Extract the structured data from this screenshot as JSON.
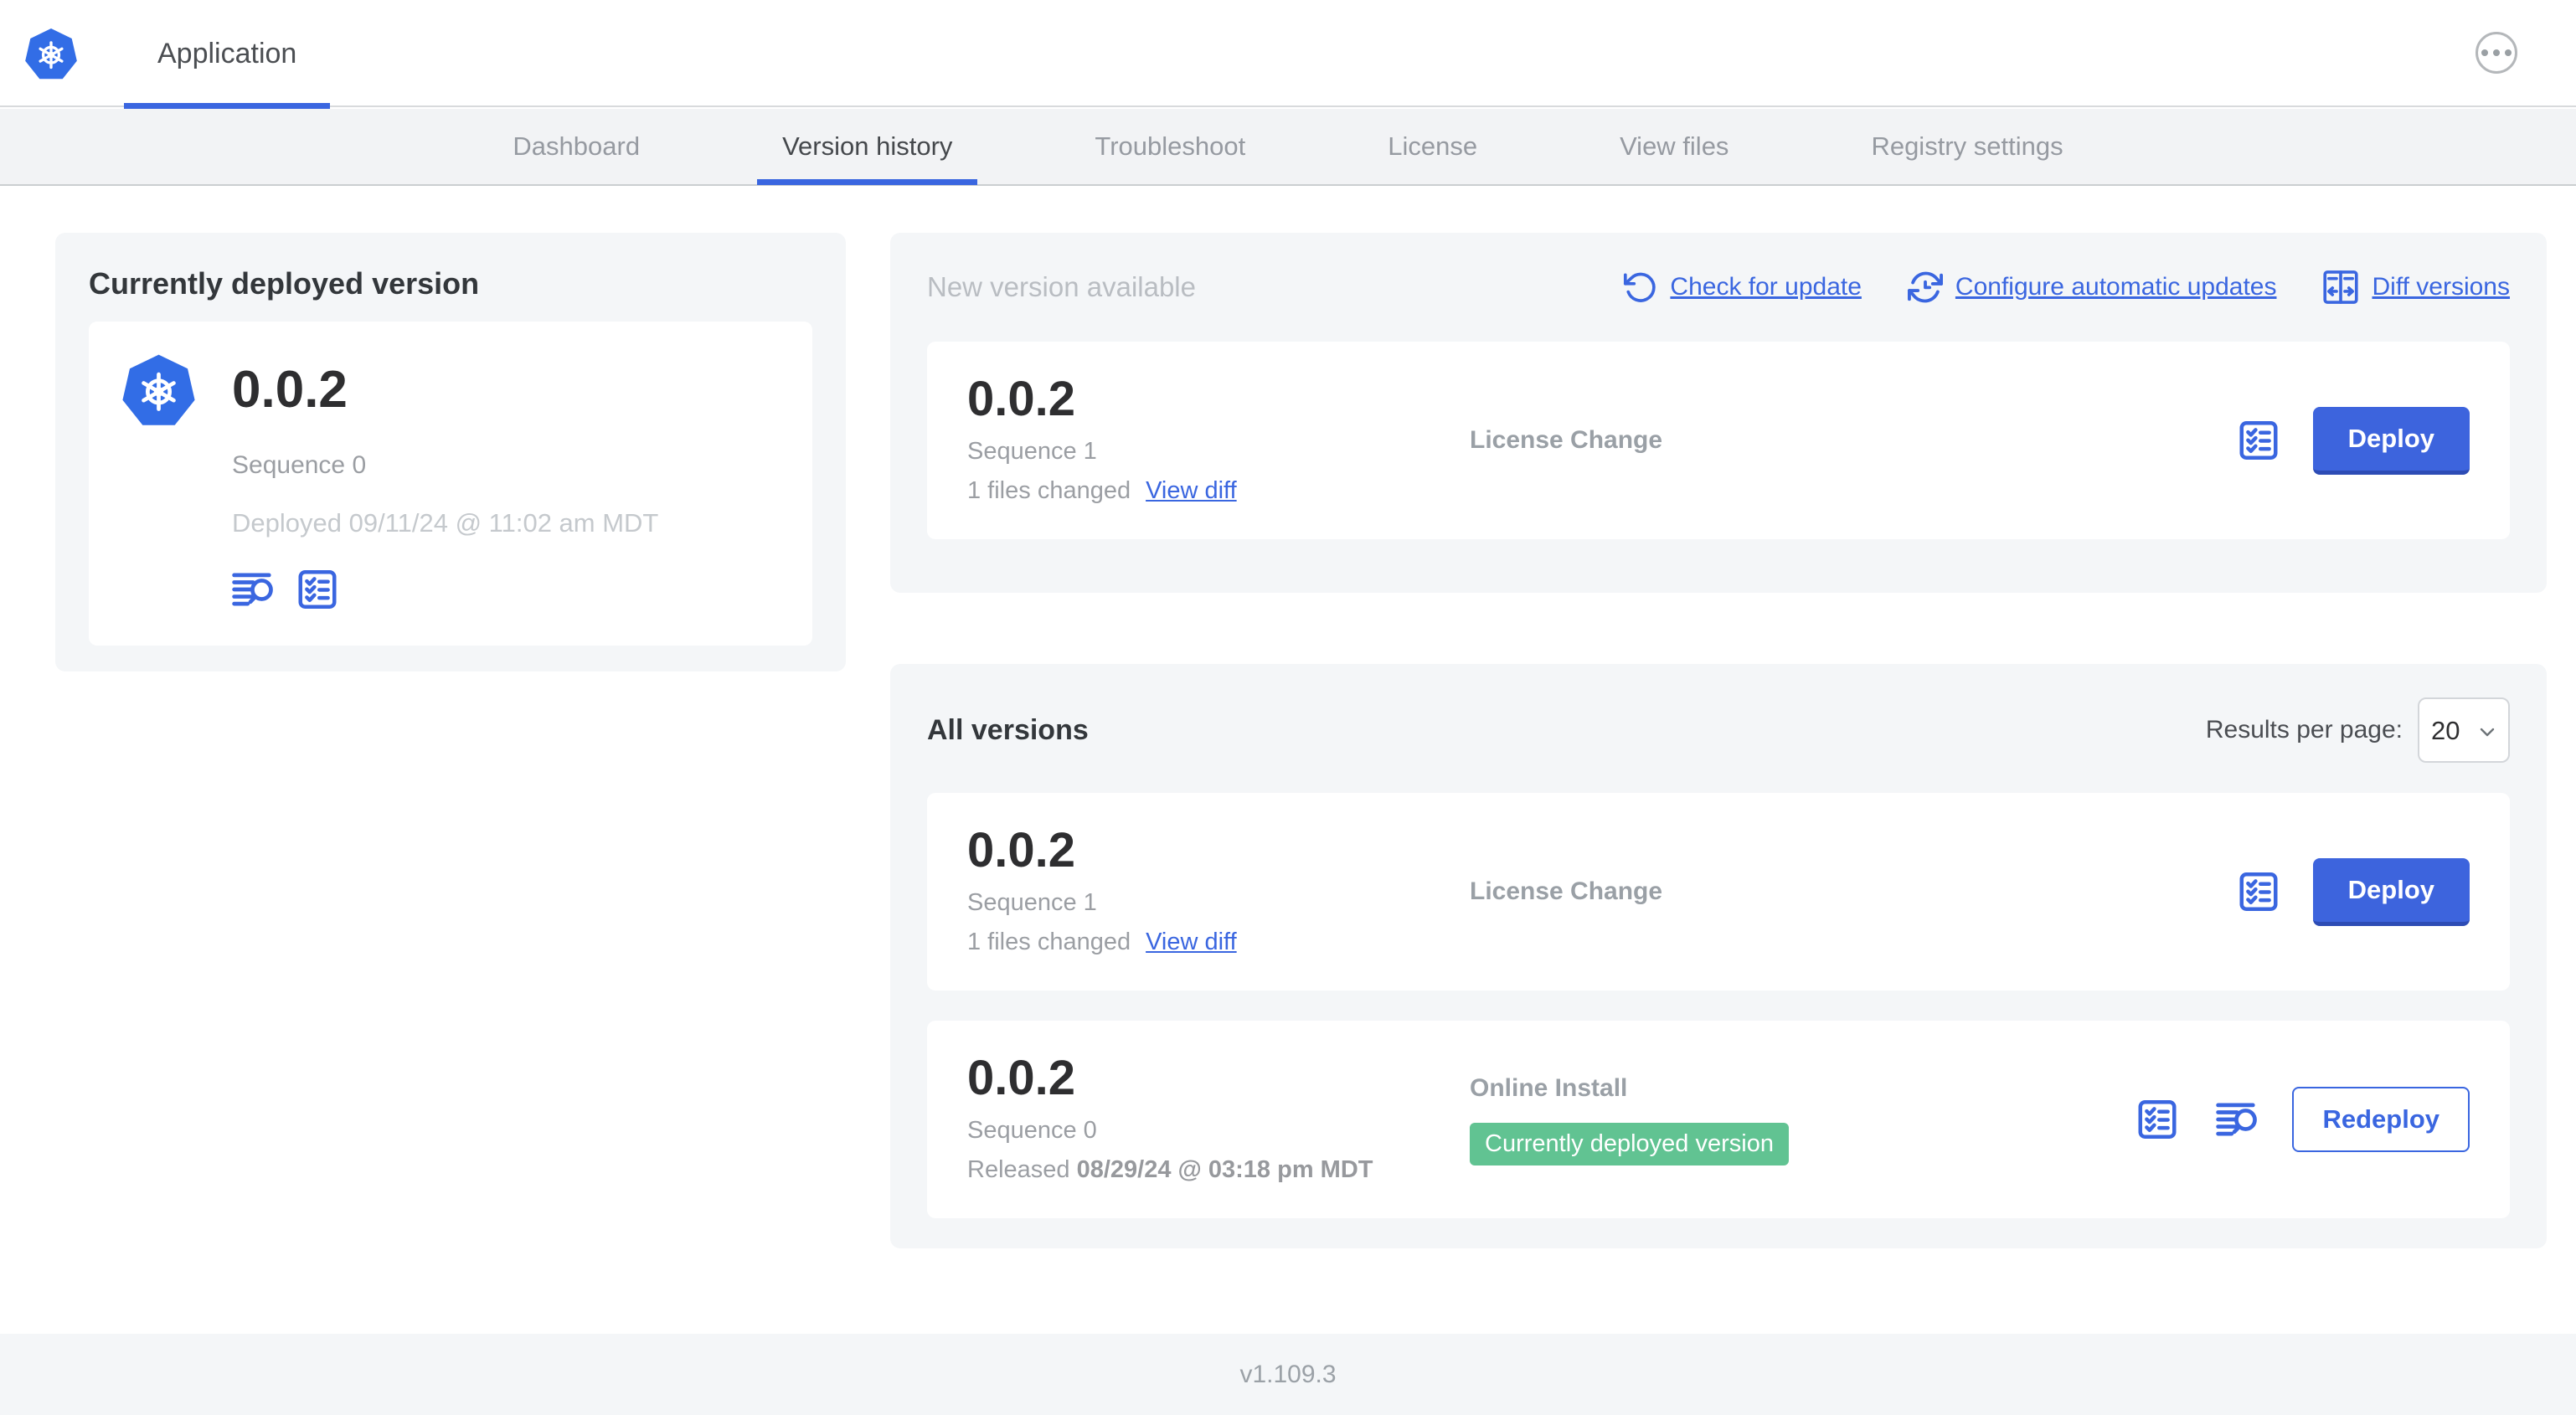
{
  "colors": {
    "accent_blue": "#3a66e0",
    "k8s_blue": "#326de6",
    "badge_green": "#61c392",
    "panel_gray": "#f4f6f8",
    "primary_button_blue": "#3d64dd"
  },
  "topbar": {
    "app_tab_label": "Application"
  },
  "nav": {
    "tabs": [
      {
        "label": "Dashboard",
        "active": false
      },
      {
        "label": "Version history",
        "active": true
      },
      {
        "label": "Troubleshoot",
        "active": false
      },
      {
        "label": "License",
        "active": false
      },
      {
        "label": "View files",
        "active": false
      },
      {
        "label": "Registry settings",
        "active": false
      }
    ]
  },
  "current_version_panel": {
    "title": "Currently deployed version",
    "version": "0.0.2",
    "sequence": "Sequence 0",
    "deployed_timestamp": "Deployed 09/11/24 @ 11:02 am MDT"
  },
  "new_version_panel": {
    "title": "New version available",
    "actions": [
      {
        "icon": "refresh-icon",
        "label": "Check for update"
      },
      {
        "icon": "auto-update-clock-icon",
        "label": "Configure automatic updates"
      },
      {
        "icon": "diff-icon",
        "label": "Diff versions"
      }
    ],
    "card": {
      "version": "0.0.2",
      "sequence": "Sequence 1",
      "files_changed": "1 files changed",
      "view_diff_label": "View diff",
      "source": "License Change",
      "action_label": "Deploy"
    }
  },
  "all_versions_panel": {
    "title": "All versions",
    "results_per_page_label": "Results per page:",
    "results_per_page_value": "20",
    "rows": [
      {
        "version": "0.0.2",
        "sequence": "Sequence 1",
        "files_changed": "1 files changed",
        "view_diff_label": "View diff",
        "source": "License Change",
        "action_label": "Deploy"
      },
      {
        "version": "0.0.2",
        "sequence": "Sequence 0",
        "released_label": "Released",
        "released_timestamp": "08/29/24 @ 03:18 pm MDT",
        "source": "Online Install",
        "badge_label": "Currently deployed version",
        "action_label": "Redeploy"
      }
    ]
  },
  "footer": {
    "app_version": "v1.109.3"
  }
}
